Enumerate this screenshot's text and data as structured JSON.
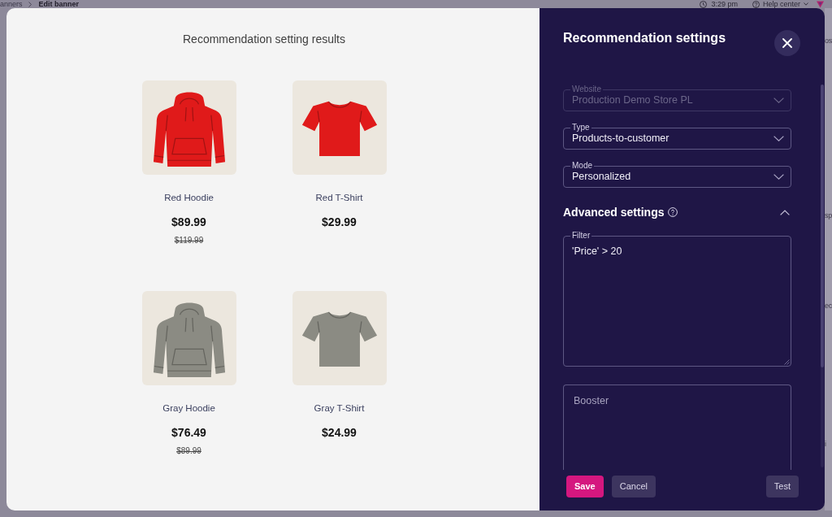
{
  "background": {
    "breadcrumb": [
      "anners",
      "Edit banner"
    ],
    "time": "3:29 pm",
    "help_link": "Help center",
    "edge_texts": [
      "os",
      "sp",
      "ec",
      "i"
    ]
  },
  "results": {
    "title": "Recommendation setting results",
    "products": [
      {
        "kind": "hoodie",
        "color": "#e01a1a",
        "name": "Red Hoodie",
        "price": "$89.99",
        "old_price": "$119.99"
      },
      {
        "kind": "t-shirt",
        "color": "#e01a1a",
        "name": "Red T-Shirt",
        "price": "$29.99"
      },
      {
        "kind": "hoodie",
        "color": "#8b8b83",
        "name": "Gray Hoodie",
        "price": "$76.49",
        "old_price": "$89.99"
      },
      {
        "kind": "t-shirt",
        "color": "#8b8b83",
        "name": "Gray T-Shirt",
        "price": "$24.99"
      }
    ]
  },
  "settings": {
    "title": "Recommendation settings",
    "fields": [
      {
        "kind": "select",
        "label": "Website",
        "value": "Production Demo Store PL",
        "disabled": true
      },
      {
        "kind": "select",
        "label": "Type",
        "value": "Products-to-customer",
        "disabled": false
      },
      {
        "kind": "select",
        "label": "Mode",
        "value": "Personalized",
        "disabled": false
      }
    ],
    "advanced": {
      "title": "Advanced settings",
      "expanded": true,
      "fields": [
        {
          "kind": "textarea",
          "label": "Filter",
          "value": "'Price' > 20"
        },
        {
          "kind": "textarea",
          "placeholder": "Booster"
        }
      ]
    },
    "buttons": [
      {
        "kind": "save",
        "label": "Save"
      },
      {
        "kind": "cancel",
        "label": "Cancel"
      },
      {
        "kind": "test",
        "label": "Test"
      }
    ]
  }
}
